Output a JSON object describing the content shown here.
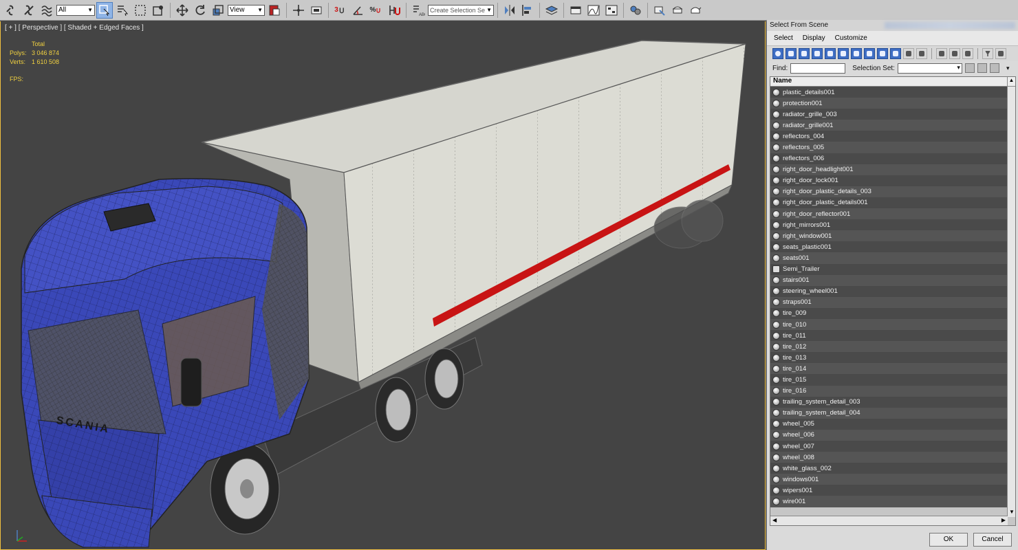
{
  "toolbar": {
    "filter_value": "All",
    "coord_value": "View",
    "snap_3": "3",
    "snap_percent": "%",
    "named_selection_placeholder": "Create Selection Se",
    "icons": [
      "link-icon",
      "unlink-icon",
      "bind-spacewarp-icon",
      "select-filter",
      "select-object-icon",
      "select-by-name-icon",
      "rect-region-icon",
      "window-crossing-icon",
      "move-icon",
      "rotate-icon",
      "scale-icon",
      "ref-coord",
      "pivot-icon",
      "select-manipulate-icon",
      "keyboard-override-icon",
      "snap-3d-icon",
      "angle-snap-icon",
      "percent-snap-icon",
      "spinner-snap-icon",
      "edit-named-sel-icon",
      "named-sel",
      "mirror-icon",
      "align-icon",
      "layers-icon",
      "ribbon-icon",
      "curve-editor-icon",
      "schematic-icon",
      "material-editor-icon",
      "render-setup-icon",
      "rendered-frame-icon",
      "render-icon"
    ]
  },
  "viewport": {
    "label": "[ + ] [ Perspective ] [ Shaded + Edged Faces ]",
    "stats_header": "Total",
    "polys_label": "Polys:",
    "polys_value": "3 046 874",
    "verts_label": "Verts:",
    "verts_value": "1 610 508",
    "fps_label": "FPS:",
    "brand_text": "SCANIA"
  },
  "dialog": {
    "title": "Select From Scene",
    "menu": [
      "Select",
      "Display",
      "Customize"
    ],
    "find_label": "Find:",
    "selection_set_label": "Selection Set:",
    "column_name": "Name",
    "ok_label": "OK",
    "cancel_label": "Cancel",
    "items": [
      {
        "name": "plastic_details001",
        "type": "object"
      },
      {
        "name": "protection001",
        "type": "object"
      },
      {
        "name": "radiator_grille_003",
        "type": "object"
      },
      {
        "name": "radiator_grille001",
        "type": "object"
      },
      {
        "name": "reflectors_004",
        "type": "object"
      },
      {
        "name": "reflectors_005",
        "type": "object"
      },
      {
        "name": "reflectors_006",
        "type": "object"
      },
      {
        "name": "right_door_headlight001",
        "type": "object"
      },
      {
        "name": "right_door_lock001",
        "type": "object"
      },
      {
        "name": "right_door_plastic_details_003",
        "type": "object"
      },
      {
        "name": "right_door_plastic_details001",
        "type": "object"
      },
      {
        "name": "right_door_reflector001",
        "type": "object"
      },
      {
        "name": "right_mirrors001",
        "type": "object"
      },
      {
        "name": "right_window001",
        "type": "object"
      },
      {
        "name": "seats_plastic001",
        "type": "object"
      },
      {
        "name": "seats001",
        "type": "object"
      },
      {
        "name": "Semi_Trailer",
        "type": "group"
      },
      {
        "name": "stairs001",
        "type": "object"
      },
      {
        "name": "steering_wheel001",
        "type": "object"
      },
      {
        "name": "straps001",
        "type": "object"
      },
      {
        "name": "tire_009",
        "type": "object"
      },
      {
        "name": "tire_010",
        "type": "object"
      },
      {
        "name": "tire_011",
        "type": "object"
      },
      {
        "name": "tire_012",
        "type": "object"
      },
      {
        "name": "tire_013",
        "type": "object"
      },
      {
        "name": "tire_014",
        "type": "object"
      },
      {
        "name": "tire_015",
        "type": "object"
      },
      {
        "name": "tire_016",
        "type": "object"
      },
      {
        "name": "trailing_system_detail_003",
        "type": "object"
      },
      {
        "name": "trailing_system_detail_004",
        "type": "object"
      },
      {
        "name": "wheel_005",
        "type": "object"
      },
      {
        "name": "wheel_006",
        "type": "object"
      },
      {
        "name": "wheel_007",
        "type": "object"
      },
      {
        "name": "wheel_008",
        "type": "object"
      },
      {
        "name": "white_glass_002",
        "type": "object"
      },
      {
        "name": "windows001",
        "type": "object"
      },
      {
        "name": "wipers001",
        "type": "object"
      },
      {
        "name": "wire001",
        "type": "object"
      }
    ]
  },
  "colors": {
    "viewport_bg": "#444444",
    "stats": "#f0d040",
    "cab": "#3a48b8",
    "trailer": "#dcdcd4",
    "stripe": "#c81414",
    "active_border": "#f0c040"
  }
}
